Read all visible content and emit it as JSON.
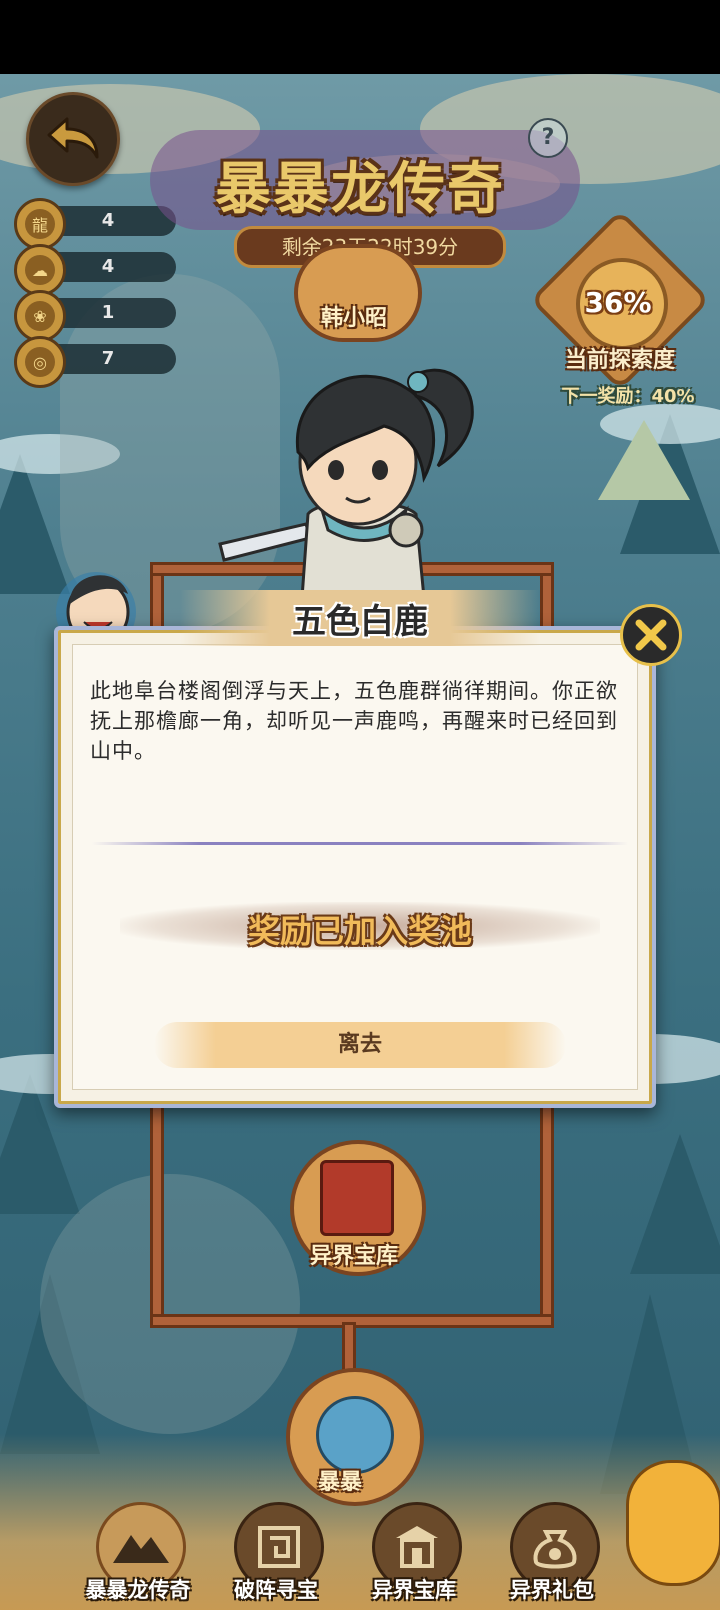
{
  "hud": {
    "resources": [
      {
        "icon": "fire-dragon-icon",
        "value": "4"
      },
      {
        "icon": "water-dragon-icon",
        "value": "4"
      },
      {
        "icon": "wind-dragon-icon",
        "value": "1"
      },
      {
        "icon": "swirl-icon",
        "value": "7"
      }
    ],
    "help_label": "?"
  },
  "header": {
    "title": "暴暴龙传奇",
    "timer": "剩余23天22时39分"
  },
  "exploration": {
    "percent_text": "36%",
    "percent": 36,
    "label": "当前探索度",
    "next_reward": "下一奖励：40%"
  },
  "map": {
    "top_node_label": "韩小昭",
    "treasury_node_label": "异界宝库",
    "bottom_node_label": "暴暴"
  },
  "dialog": {
    "title": "五色白鹿",
    "description": "此地阜台楼阁倒浮与天上，五色鹿群徜徉期间。你正欲抚上那檐廊一角，却听见一声鹿鸣，再醒来时已经回到山中。",
    "reward_status": "奖励已加入奖池",
    "leave_label": "离去"
  },
  "bottom_nav": [
    {
      "label": "暴暴龙传奇",
      "icon": "mountain-icon"
    },
    {
      "label": "破阵寻宝",
      "icon": "maze-icon"
    },
    {
      "label": "异界宝库",
      "icon": "temple-icon"
    },
    {
      "label": "异界礼包",
      "icon": "coin-bag-icon"
    }
  ],
  "colors": {
    "title_gold": "#e9c86a",
    "reward_gold": "#f1bb5a",
    "dialog_bg": "#fbf8f0",
    "dialog_border": "#a9b6d8"
  }
}
